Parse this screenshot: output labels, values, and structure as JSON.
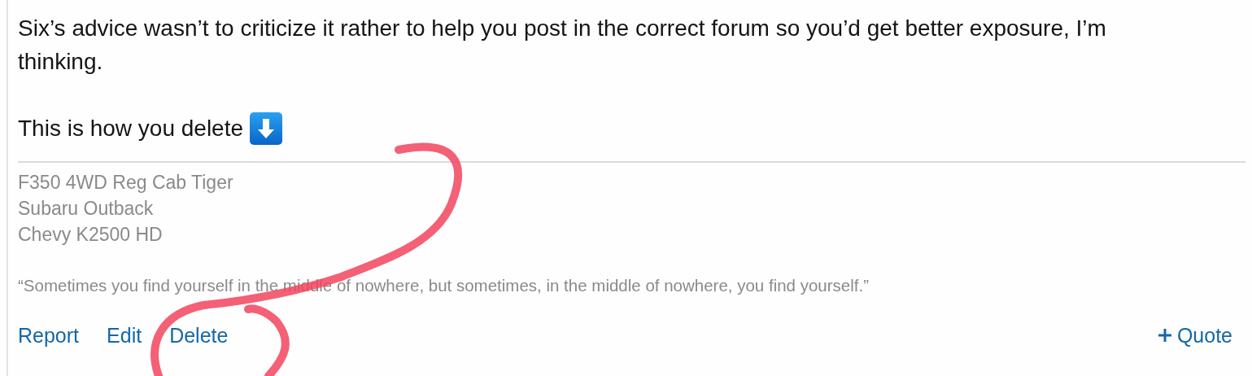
{
  "post": {
    "paragraphs": [
      {
        "kind": "text",
        "text": "Six’s advice wasn’t to criticize it rather to help you post in the correct forum so you’d get better exposure, I’m thinking."
      },
      {
        "kind": "with_arrow",
        "text": "This is how you delete"
      }
    ]
  },
  "signature": {
    "lines": [
      "F350 4WD Reg Cab Tiger",
      "Subaru Outback",
      "Chevy K2500 HD"
    ],
    "quote": "“Sometimes you find yourself in the middle of nowhere, but sometimes, in the middle of nowhere, you find yourself.”"
  },
  "actions": {
    "left": [
      "Report",
      "Edit",
      "Delete"
    ],
    "right": "Quote"
  }
}
